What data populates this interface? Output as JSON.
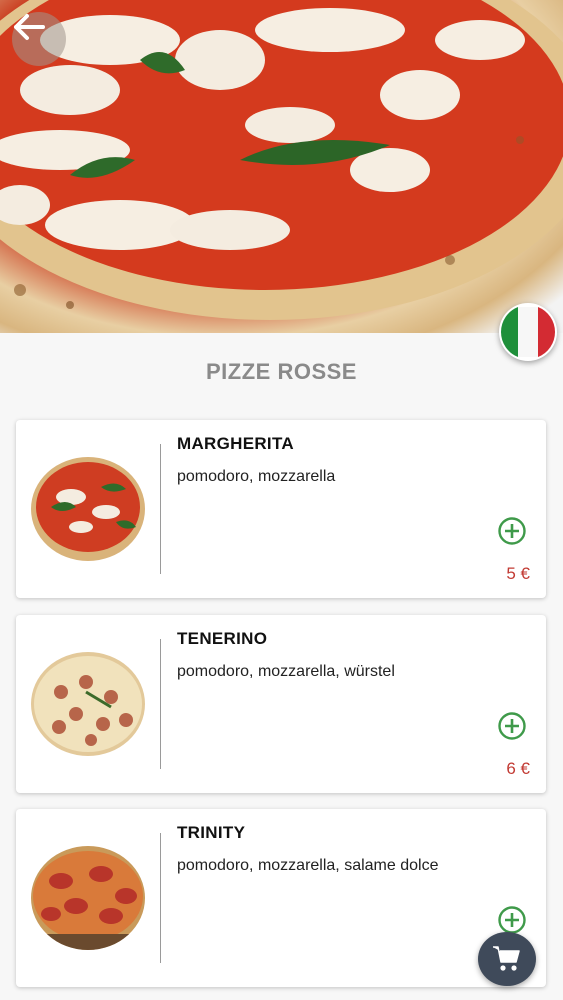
{
  "section": {
    "title": "PIZZE ROSSE"
  },
  "language_flag": "italian-flag",
  "products": [
    {
      "name": "MARGHERITA",
      "ingredients": "pomodoro, mozzarella",
      "price": "5 €"
    },
    {
      "name": "TENERINO",
      "ingredients": "pomodoro, mozzarella, würstel",
      "price": "6 €"
    },
    {
      "name": "TRINITY",
      "ingredients": "pomodoro, mozzarella, salame dolce",
      "price": ""
    }
  ],
  "colors": {
    "accent_green": "#3f9a4a",
    "price_red": "#c23a33",
    "cart_bg": "#3f4a5a"
  }
}
